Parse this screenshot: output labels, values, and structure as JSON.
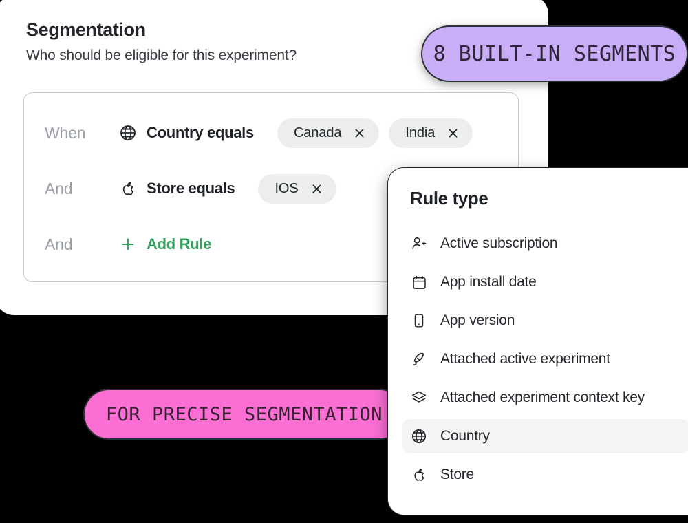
{
  "segmentation_card": {
    "title": "Segmentation",
    "subtitle": "Who should be eligible for this experiment?",
    "rules": [
      {
        "conjunction": "When",
        "icon": "globe-icon",
        "label": "Country equals",
        "chips": [
          "Canada",
          "India"
        ]
      },
      {
        "conjunction": "And",
        "icon": "apple-icon",
        "label": "Store equals",
        "chips": [
          "IOS"
        ]
      },
      {
        "conjunction": "And",
        "icon": "plus-icon",
        "label": "Add Rule",
        "chips": []
      }
    ]
  },
  "badges": {
    "segments": {
      "text": "8 BUILT-IN SEGMENTS",
      "background": "#c9aef7",
      "border": "#2b2f36"
    },
    "precise": {
      "text": "FOR PRECISE SEGMENTATION",
      "background": "#fb6fd4",
      "border": "#2b2f36"
    }
  },
  "rule_type_panel": {
    "title": "Rule type",
    "items": [
      {
        "label": "Active subscription",
        "icon": "user-plus-icon",
        "selected": false
      },
      {
        "label": "App install date",
        "icon": "calendar-icon",
        "selected": false
      },
      {
        "label": "App version",
        "icon": "mobile-icon",
        "selected": false
      },
      {
        "label": "Attached active experiment",
        "icon": "rocket-icon",
        "selected": false
      },
      {
        "label": "Attached experiment context key",
        "icon": "layers-icon",
        "selected": false
      },
      {
        "label": "Country",
        "icon": "globe-icon",
        "selected": true
      },
      {
        "label": "Store",
        "icon": "apple-icon",
        "selected": false
      }
    ]
  },
  "colors": {
    "accent_green": "#34a35f",
    "chip_background": "#eceded",
    "selected_row": "#f4f4f5",
    "page_background": "#000000"
  }
}
